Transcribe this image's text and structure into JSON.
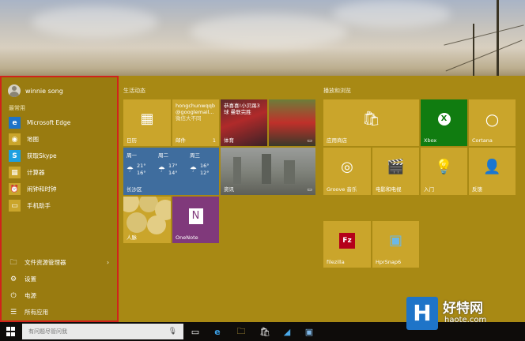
{
  "user": {
    "name": "winnie song"
  },
  "left_pane": {
    "most_used_label": "最常用",
    "apps": [
      {
        "label": "Microsoft Edge",
        "icon": "edge-icon",
        "glyph": "e",
        "color": "#1e73c8"
      },
      {
        "label": "地图",
        "icon": "maps-icon",
        "glyph": "◉",
        "color": "#caa52b"
      },
      {
        "label": "获取Skype",
        "icon": "skype-icon",
        "glyph": "S",
        "color": "#1ea0e0"
      },
      {
        "label": "计算器",
        "icon": "calculator-icon",
        "glyph": "▦",
        "color": "#caa52b"
      },
      {
        "label": "闹钟和时钟",
        "icon": "alarm-clock-icon",
        "glyph": "⏰",
        "color": "#caa52b"
      },
      {
        "label": "手机助手",
        "icon": "phone-assistant-icon",
        "glyph": "▭",
        "color": "#caa52b"
      }
    ],
    "bottom": [
      {
        "label": "文件资源管理器",
        "icon": "file-explorer-icon",
        "glyph": "🗀",
        "chevron": "›"
      },
      {
        "label": "设置",
        "icon": "settings-gear-icon",
        "glyph": "⚙",
        "chevron": ""
      },
      {
        "label": "电源",
        "icon": "power-icon",
        "glyph": "⏻",
        "chevron": ""
      },
      {
        "label": "所有应用",
        "icon": "all-apps-icon",
        "glyph": "☰",
        "chevron": ""
      }
    ]
  },
  "groups": {
    "life": "生活动态",
    "play": "播放和浏览"
  },
  "tiles": {
    "calendar": {
      "label": "日历",
      "glyph": "▦"
    },
    "mail": {
      "label": "邮件",
      "line1": "hongchunwqqb",
      "line2": "@googlemail...",
      "line3": "微信大不同",
      "count": "1"
    },
    "sports": {
      "label": "体育",
      "headline": "恭喜喜!小贝踢3球 曼联完胜"
    },
    "photos": {
      "label": "",
      "glyph": "▭"
    },
    "weather": {
      "label": "长沙区",
      "days": [
        {
          "day": "周一",
          "hi": "21°",
          "lo": "16°",
          "icon": "cloudy-rain-icon"
        },
        {
          "day": "周二",
          "hi": "17°",
          "lo": "14°",
          "icon": "cloudy-rain-icon"
        },
        {
          "day": "周三",
          "hi": "16°",
          "lo": "12°",
          "icon": "cloudy-rain-icon"
        }
      ]
    },
    "news": {
      "label": "资讯",
      "glyph": "▭"
    },
    "people": {
      "label": "人脉"
    },
    "onenote": {
      "label": "OneNote",
      "glyph": "N"
    },
    "store": {
      "label": "应用商店",
      "glyph": "🛍"
    },
    "xbox": {
      "label": "Xbox",
      "glyph": "X"
    },
    "cortana": {
      "label": "Cortana",
      "glyph": "○"
    },
    "groove": {
      "label": "Groove 音乐",
      "glyph": "◎"
    },
    "movies": {
      "label": "电影和电视",
      "glyph": "🎬"
    },
    "tips": {
      "label": "入门",
      "glyph": "💡"
    },
    "feedback": {
      "label": "反馈",
      "glyph": "👤"
    },
    "filezilla": {
      "label": "filezilla",
      "glyph": "Fz"
    },
    "hprsnap": {
      "label": "HprSnap6",
      "glyph": "▣"
    }
  },
  "taskbar": {
    "search_placeholder": "有问题尽管问我",
    "mic": "🎙"
  },
  "watermark": {
    "text": "好特网",
    "url": "haote.com",
    "logo": "H"
  },
  "colors": {
    "start_bg": "#a88914",
    "tile": "#caa52b",
    "xbox": "#107c10",
    "onenote": "#80397b",
    "weather": "#3f6d9e",
    "highlight": "#d0231b"
  }
}
